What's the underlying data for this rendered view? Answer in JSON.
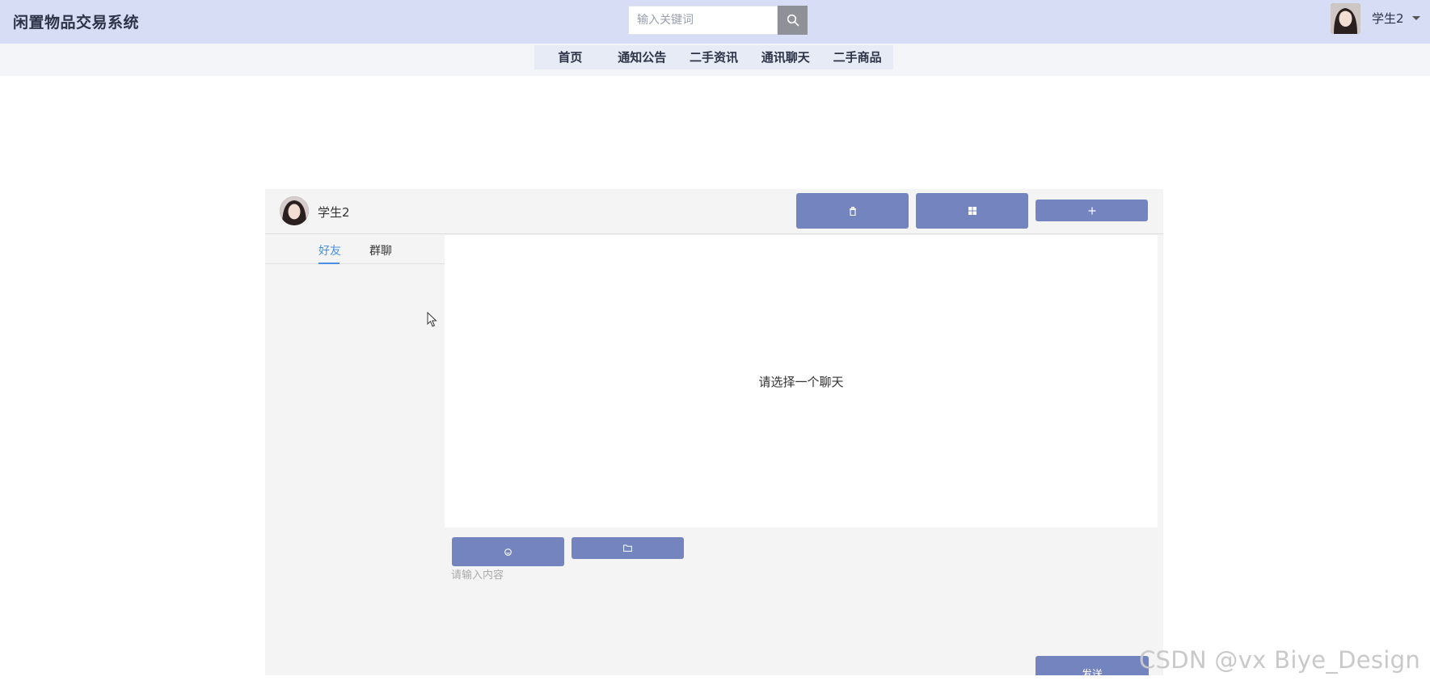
{
  "header": {
    "brand": "闲置物品交易系统",
    "search_placeholder": "输入关键词",
    "search_icon": "search-icon",
    "user_name": "学生2",
    "dropdown_icon": "caret-down-icon"
  },
  "nav": {
    "items": [
      {
        "label": "首页"
      },
      {
        "label": "通知公告"
      },
      {
        "label": "二手资讯"
      },
      {
        "label": "通讯聊天"
      },
      {
        "label": "二手商品"
      }
    ]
  },
  "chat": {
    "user_name": "学生2",
    "header_buttons": [
      "trash-icon",
      "grid-icon",
      "plus-icon"
    ],
    "tabs": [
      {
        "label": "好友",
        "active": true
      },
      {
        "label": "群聊",
        "active": false
      }
    ],
    "empty_text": "请选择一个聊天",
    "toolbar_buttons": [
      "emoji-icon",
      "folder-icon"
    ],
    "input_placeholder": "请输入内容",
    "send_label": "发送"
  },
  "watermark": "CSDN @vx Biye_Design",
  "colors": {
    "topbar": "#d6ddf4",
    "button": "#7484bf",
    "active_tab": "#4a90e2"
  }
}
